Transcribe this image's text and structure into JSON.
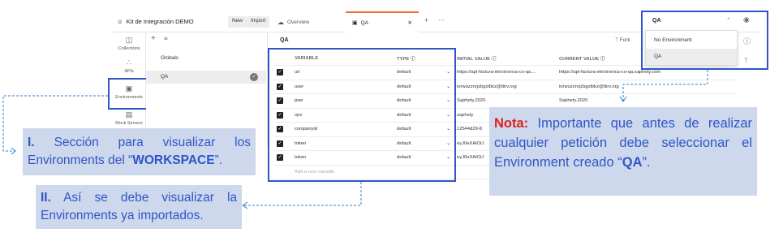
{
  "workspace": {
    "title": "Kit de Integración DEMO",
    "new_label": "New",
    "import_label": "Import"
  },
  "tabs": [
    {
      "label": "Overview"
    },
    {
      "label": "QA"
    }
  ],
  "env_selector": {
    "selected": "QA",
    "options": [
      "No Environment",
      "QA"
    ]
  },
  "sidebar": {
    "items": [
      {
        "label": "Collections"
      },
      {
        "label": "APIs"
      },
      {
        "label": "Environments"
      },
      {
        "label": "Mock Servers"
      }
    ]
  },
  "env_list": {
    "globals": "Globals",
    "qa": "QA"
  },
  "main": {
    "title": "QA",
    "fork_label": "Fork"
  },
  "table": {
    "headers": [
      "VARIABLE",
      "TYPE",
      "INITIAL VALUE",
      "CURRENT VALUE"
    ],
    "rows": [
      {
        "variable": "url",
        "type": "default",
        "initial": "https://api-factura-electronica-co-qa....",
        "current": "https://api-factura-electronica-co-qa.saphety.com"
      },
      {
        "variable": "user",
        "type": "default",
        "initial": "iorwuzznrjzbgztbkz@ttirv.org",
        "current": "iorwuzznrjzbgztbkz@ttirv.org"
      },
      {
        "variable": "psw",
        "type": "default",
        "initial": "Saphety.2020",
        "current": "Saphety.2020"
      },
      {
        "variable": "opv",
        "type": "default",
        "initial": "saphety",
        "current": ""
      },
      {
        "variable": "companyid",
        "type": "default",
        "initial": "12544d29-8",
        "current": ""
      },
      {
        "variable": "token",
        "type": "default",
        "initial": "eyJ0eXAiOiJ",
        "current": ""
      },
      {
        "variable": "token",
        "type": "default",
        "initial": "eyJ0eXAiOiJ",
        "current": ""
      }
    ],
    "add_placeholder": "Add a new variable"
  },
  "callouts": {
    "one_num": "I.",
    "one_text_a": "Sección para visualizar los Environments del “",
    "one_bold": "WORKSPACE",
    "one_text_b": "”.",
    "two_num": "II.",
    "two_text": "Así se debe visualizar la Environments ya importados.",
    "nota_label": "Nota:",
    "nota_text_a": "Importante que antes de realizar cualquier petición debe seleccionar el Environment creado “",
    "nota_bold": "QA",
    "nota_text_b": "”."
  },
  "colors": {
    "accent_blue": "#2f55c8",
    "callout_bg": "#cdd8ec",
    "nota_red": "#e0201b",
    "tab_orange": "#f26b3a"
  }
}
